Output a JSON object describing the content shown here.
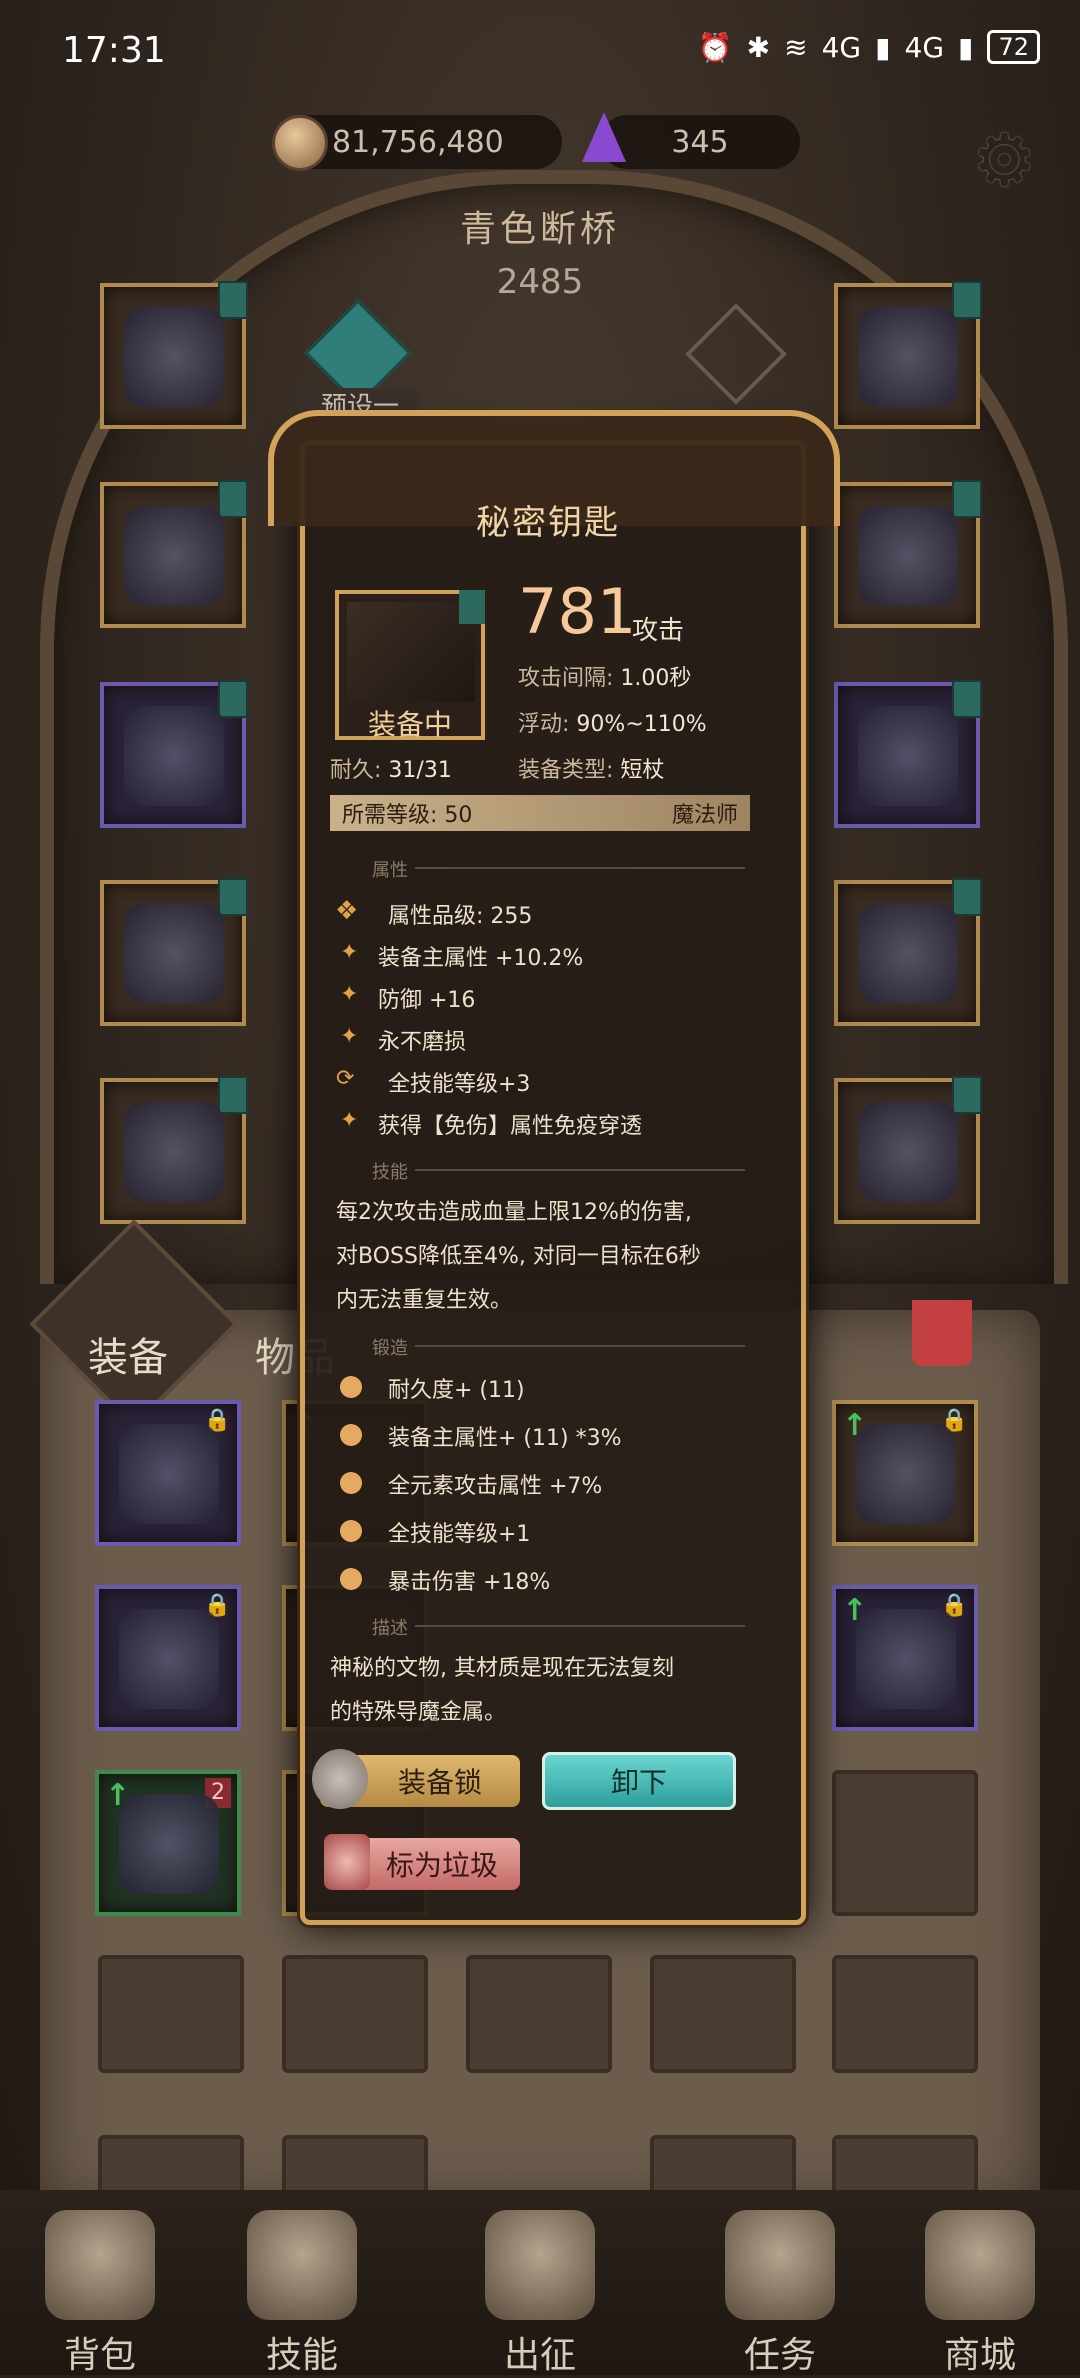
{
  "status_bar": {
    "time": "17:31",
    "network_1": "4G",
    "network_2": "4G",
    "battery": "72"
  },
  "currency": {
    "gold": "81,756,480",
    "gems": "345"
  },
  "location": {
    "title": "青色断桥",
    "power": "2485"
  },
  "preset": {
    "label": "预设一"
  },
  "tabs": {
    "equipment": "装备",
    "items": "物品"
  },
  "popup": {
    "title": "秘密钥匙",
    "equipped_badge": "装备中",
    "durability_label": "耐久:",
    "durability_value": "31/31",
    "attack_value": "781",
    "attack_label": "攻击",
    "interval_label": "攻击间隔:",
    "interval_value": "1.00秒",
    "float_label": "浮动:",
    "float_value": "90%~110%",
    "type_label": "装备类型:",
    "type_value": "短杖",
    "req_level_label": "所需等级:",
    "req_level_value": "50",
    "req_class": "魔法师",
    "sections": {
      "attributes": "属性",
      "skill": "技能",
      "forge": "锻造",
      "description": "描述"
    },
    "attributes": [
      "属性品级: 255",
      "装备主属性 +10.2%",
      "防御 +16",
      "永不磨损",
      "全技能等级+3",
      "获得【免伤】属性免疫穿透"
    ],
    "skill_lines": [
      "每2次攻击造成血量上限12%的伤害,",
      "对BOSS降低至4%, 对同一目标在6秒",
      "内无法重复生效。"
    ],
    "forge": [
      "耐久度+ (11)",
      "装备主属性+ (11) *3%",
      "全元素攻击属性 +7%",
      "全技能等级+1",
      "暴击伤害 +18%"
    ],
    "description_lines": [
      "神秘的文物, 其材质是现在无法复刻",
      "的特殊导魔金属。"
    ],
    "buttons": {
      "lock": "装备锁",
      "unequip": "卸下",
      "junk": "标为垃圾"
    }
  },
  "inventory_badge": "2",
  "nav": {
    "bag": "背包",
    "skills": "技能",
    "expedition": "出征",
    "tasks": "任务",
    "shop": "商城"
  },
  "colors": {
    "gold_frame": "#d2a25a",
    "accent_orange": "#e2a24a",
    "unequip_teal": "#3ab7b3",
    "junk_pink": "#d98a86"
  }
}
